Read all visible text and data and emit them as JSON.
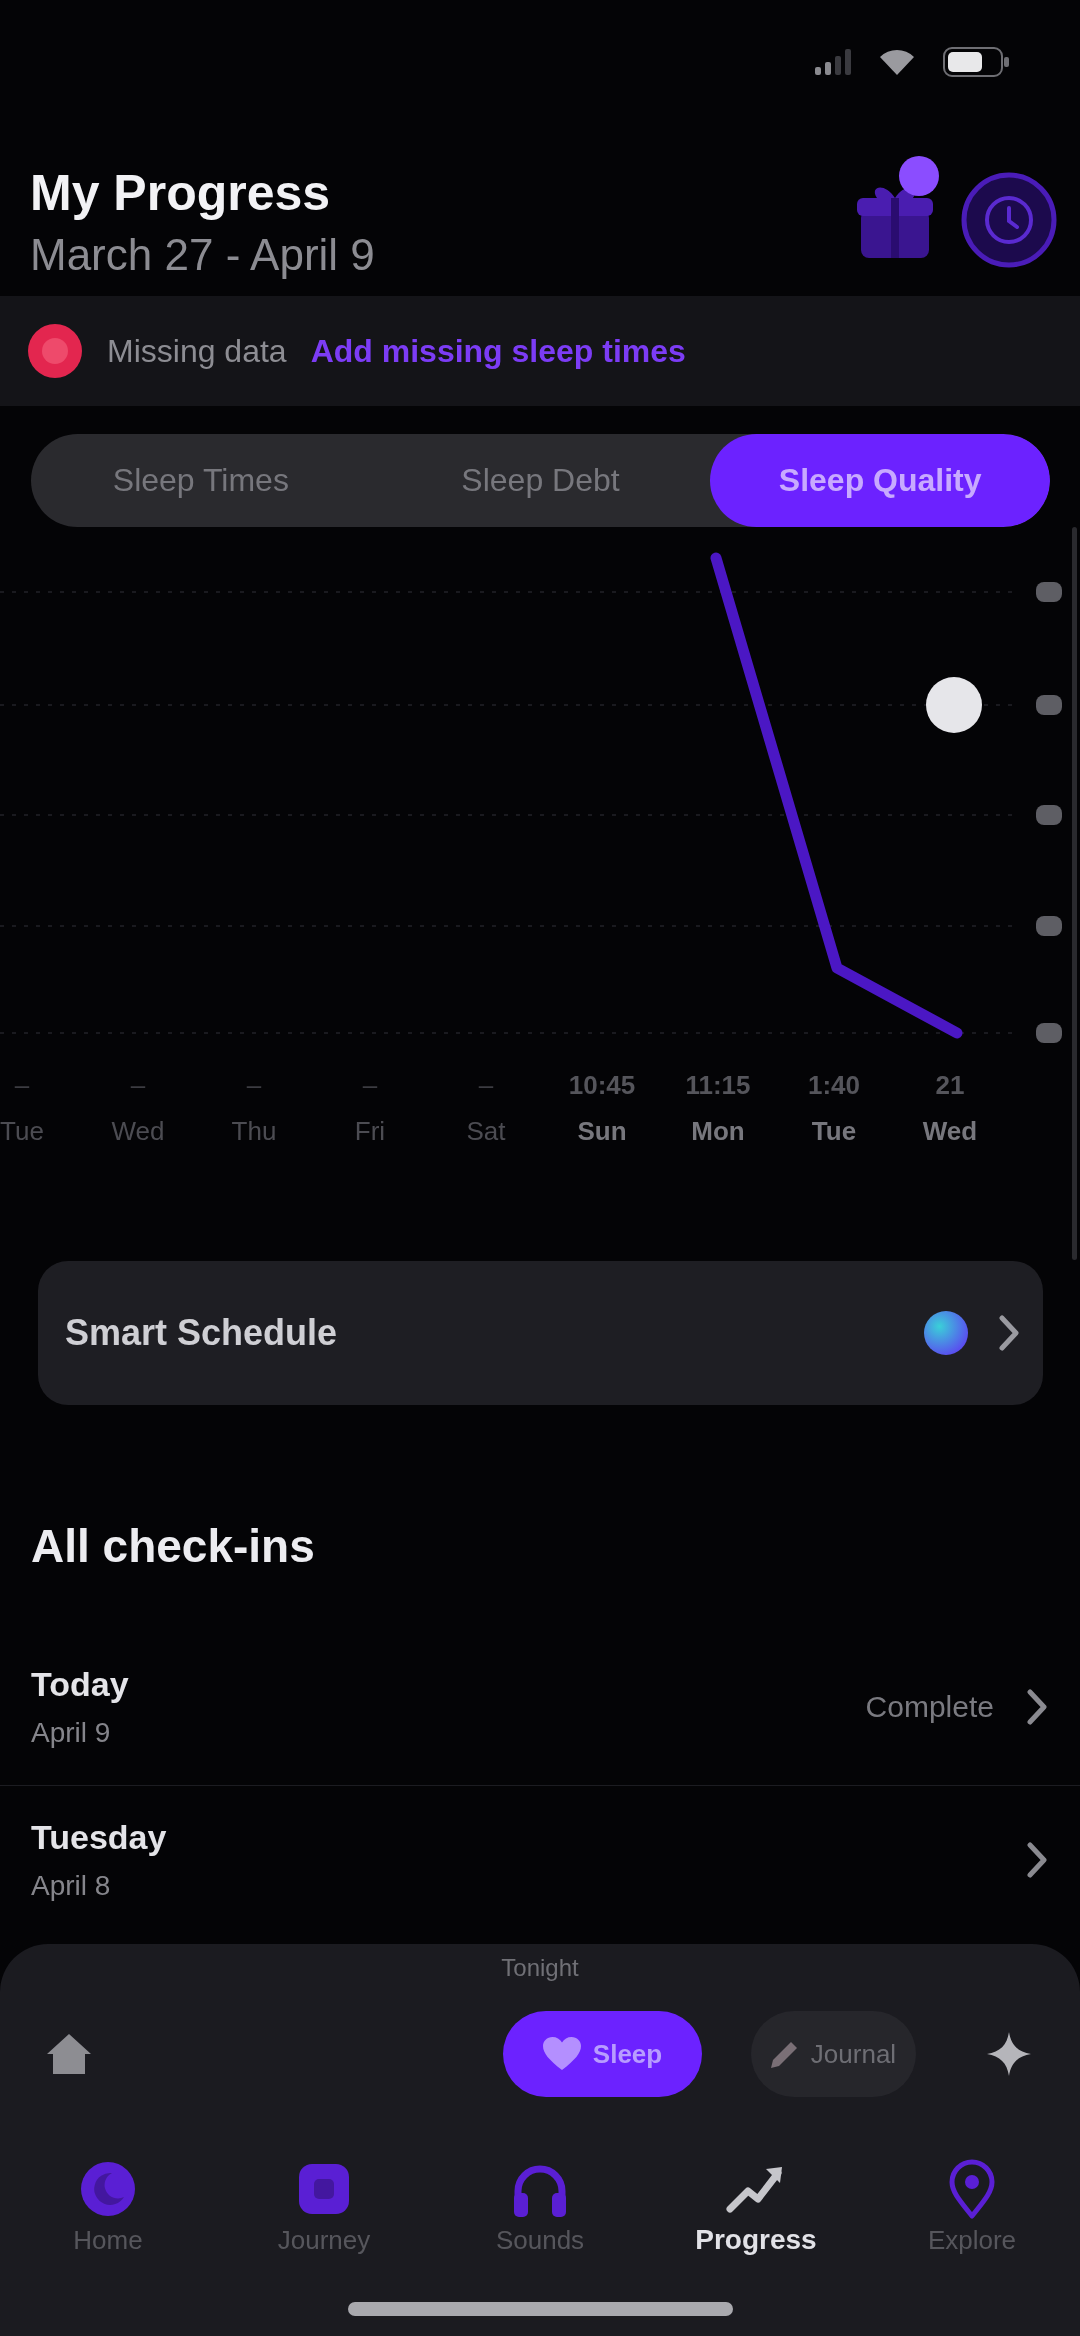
{
  "header": {
    "title": "My Progress",
    "date_range": "March 27 - April 9",
    "has_notification": true
  },
  "banner": {
    "label": "Missing data",
    "link": "Add missing sleep times"
  },
  "tabs": [
    {
      "label": "Sleep Times",
      "selected": false
    },
    {
      "label": "Sleep Debt",
      "selected": false
    },
    {
      "label": "Sleep Quality",
      "selected": true
    }
  ],
  "chart": {
    "columns": [
      {
        "kind": "missing",
        "value": "–",
        "day": "Tue"
      },
      {
        "kind": "missing",
        "value": "–",
        "day": "Wed"
      },
      {
        "kind": "missing",
        "value": "–",
        "day": "Thu"
      },
      {
        "kind": "missing",
        "value": "–",
        "day": "Fri"
      },
      {
        "kind": "missing",
        "value": "–",
        "day": "Sat"
      },
      {
        "kind": "logged",
        "value": "10:45",
        "day": "Sun"
      },
      {
        "kind": "logged",
        "value": "11:15",
        "day": "Mon"
      },
      {
        "kind": "logged",
        "value": "1:40",
        "day": "Tue"
      },
      {
        "kind": "logged",
        "value": "21",
        "day": "Wed"
      }
    ]
  },
  "smart_schedule": {
    "label": "Smart Schedule"
  },
  "check_ins": {
    "title": "All check-ins",
    "items": [
      {
        "day": "Today",
        "date": "April 9",
        "status": "Complete"
      },
      {
        "day": "Tuesday",
        "date": "April 8"
      }
    ]
  },
  "player": {
    "label": "Tonight",
    "actions": [
      {
        "kind": "primary",
        "label": "Sleep"
      },
      {
        "kind": "secondary",
        "label": "Journal"
      }
    ]
  },
  "nav": [
    {
      "label": "Home",
      "selected": false
    },
    {
      "label": "Journey",
      "selected": false
    },
    {
      "label": "Sounds",
      "selected": false
    },
    {
      "label": "Progress",
      "selected": true
    },
    {
      "label": "Explore",
      "selected": false
    }
  ]
}
